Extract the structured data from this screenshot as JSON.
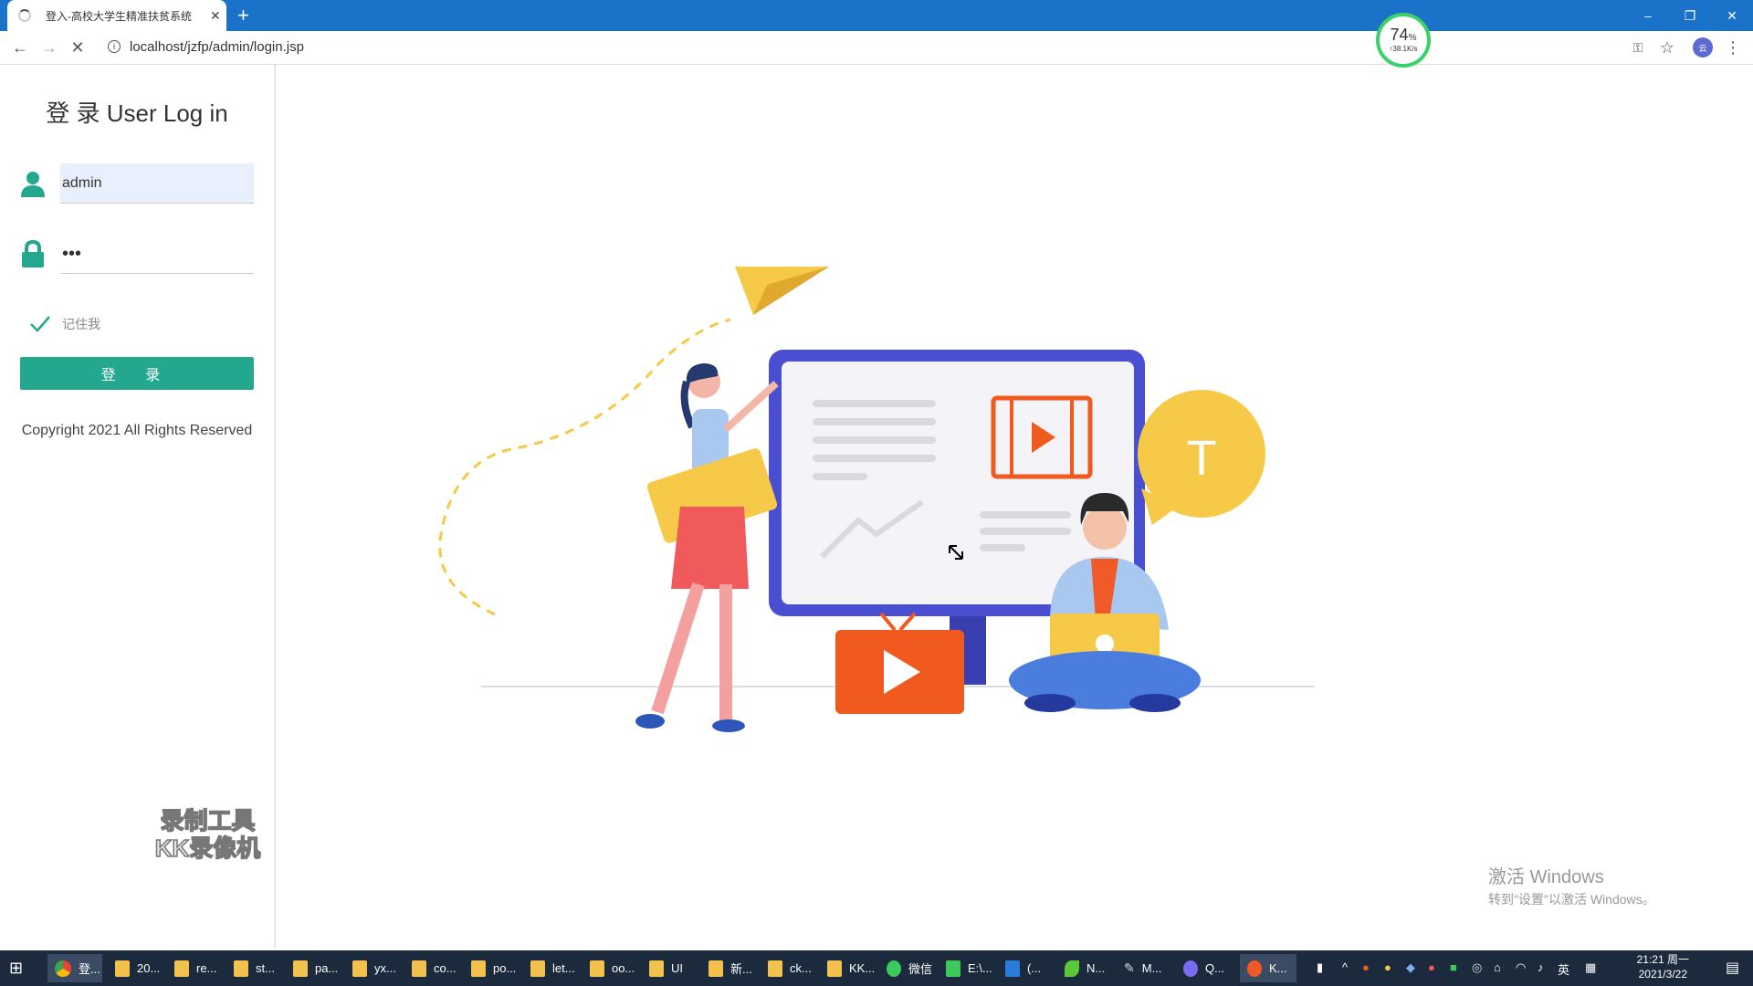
{
  "browser": {
    "tab_title": "登入-高校大学生精准扶贫系统",
    "new_tab": "+",
    "url": "localhost/jzfp/admin/login.jsp",
    "window_controls": {
      "minimize": "–",
      "restore": "❐",
      "close": "✕"
    }
  },
  "speed_gauge": {
    "percent": "74",
    "percent_unit": "%",
    "rate": "↑38.1K/s"
  },
  "login": {
    "title": "登 录 User Log in",
    "username_value": "admin",
    "password_value": "•••",
    "remember_label": "记住我",
    "submit_label": "登 录",
    "copyright": "Copyright 2021 All Rights Reserved"
  },
  "watermark": {
    "line1": "录制工具",
    "line2": "KK录像机"
  },
  "activation": {
    "line1": "激活 Windows",
    "line2": "转到\"设置\"以激活 Windows。"
  },
  "taskbar": {
    "items": [
      {
        "label": "登..."
      },
      {
        "label": "20..."
      },
      {
        "label": "re..."
      },
      {
        "label": "st..."
      },
      {
        "label": "pa..."
      },
      {
        "label": "yx..."
      },
      {
        "label": "co..."
      },
      {
        "label": "po..."
      },
      {
        "label": "let..."
      },
      {
        "label": "oo..."
      },
      {
        "label": "UI"
      },
      {
        "label": "新..."
      },
      {
        "label": "ck..."
      },
      {
        "label": "KK..."
      },
      {
        "label": "微信"
      },
      {
        "label": "E:\\..."
      },
      {
        "label": "(..."
      },
      {
        "label": "N..."
      },
      {
        "label": "M..."
      },
      {
        "label": "Q..."
      },
      {
        "label": "K..."
      }
    ],
    "ime": "英",
    "time": "21:21 周一",
    "date": "2021/3/22"
  },
  "colors": {
    "accent": "#23a78f",
    "browser_bar": "#1a73c8",
    "illustration_blue": "#4a4fd1",
    "orange": "#f05a1e",
    "yellow": "#f7c948"
  }
}
